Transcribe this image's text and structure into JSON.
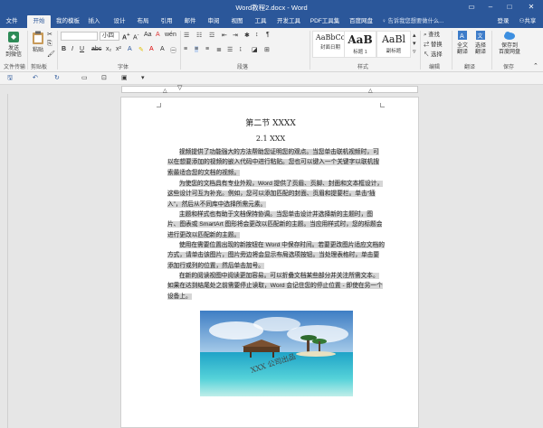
{
  "window": {
    "title": "Word教程2.docx - Word"
  },
  "tabs": [
    "文件",
    "开始",
    "我的模板",
    "插入",
    "设计",
    "布局",
    "引用",
    "邮件",
    "审阅",
    "视图",
    "工具",
    "开发工具",
    "PDF工具集",
    "百度网盘"
  ],
  "search": {
    "placeholder": "告诉我您想要做什么..."
  },
  "account": {
    "login": "登录",
    "share": "共享"
  },
  "ribbon": {
    "groups": [
      "文件传输",
      "剪贴板",
      "字体",
      "段落",
      "样式",
      "编辑",
      "翻译",
      "保存"
    ],
    "send_file": "发送\n到微信",
    "paste": "粘贴",
    "font_name": "",
    "font_size": "小四",
    "styles": [
      {
        "sample": "AaBbCc",
        "name": "封面日期"
      },
      {
        "sample": "AaB",
        "name": "标题 1"
      },
      {
        "sample": "AaBl",
        "name": "副标题"
      }
    ],
    "find": "查找",
    "replace": "替换",
    "select": "选择",
    "translate_full": "全文\n翻译",
    "translate_sel": "选择\n翻译",
    "save_baidu": "保存到\n百度网盘"
  },
  "document": {
    "heading1": "第二节 XXXX",
    "heading2": "2.1 XXX",
    "paragraphs": [
      "视频提供了功能强大的方法帮助您证明您的观点。当您单击联机视频时，可以在想要添加的视频的嵌入代码中进行粘贴。您也可以键入一个关键字以联机搜索最适合您的文档的视频。",
      "为使您的文档具有专业外观，Word 提供了页眉、页脚、封面和文本框设计，这些设计可互为补充。例如，您可以添加匹配的封面、页眉和提要栏。单击“插入”，然后从不同库中选择所需元素。",
      "主题和样式也有助于文档保持协调。当您单击设计并选择新的主题时，图片、图表或 SmartArt 图形将会更改以匹配新的主题。当应用样式时，您的标题会进行更改以匹配新的主题。",
      "使用在需要位置出现的新按钮在 Word 中保存时间。若要更改图片适应文档的方式，请单击该图片，图片旁边将会显示布局选项按钮。当处理表格时，单击要添加行或列的位置，然后单击加号。",
      "在新的阅读视图中阅读更加容易。可以折叠文档某些部分并关注所需文本。如果在达到结尾处之前需要停止读取，Word 会记住您的停止位置 - 即使在另一个设备上。"
    ],
    "watermark": "XXX 公司出品"
  }
}
